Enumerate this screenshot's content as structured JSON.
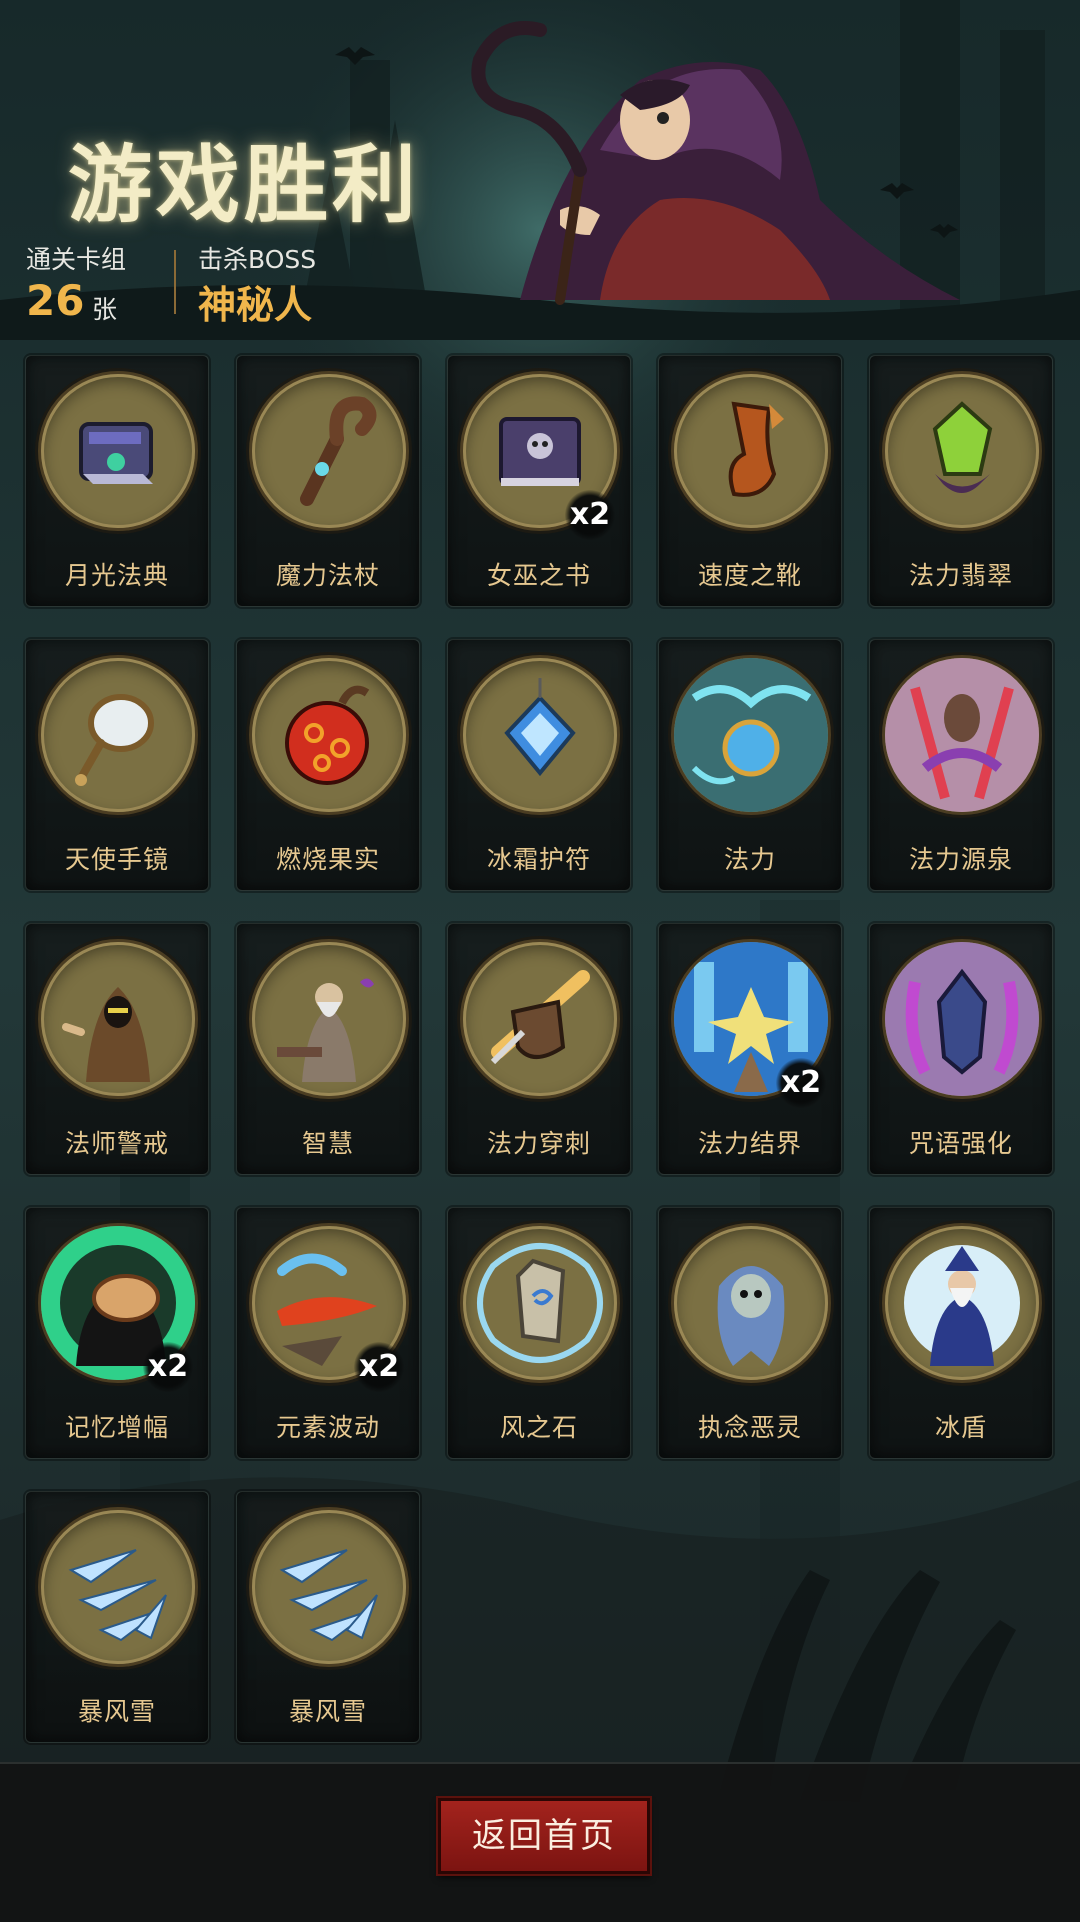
{
  "header": {
    "title": "游戏胜利",
    "deck_label": "通关卡组",
    "deck_count": "26",
    "deck_unit": "张",
    "boss_label": "击杀BOSS",
    "boss_name": "神秘人"
  },
  "cards": [
    {
      "name": "月光法典",
      "count": "",
      "icon": "moonlight-codex-icon"
    },
    {
      "name": "魔力法杖",
      "count": "",
      "icon": "magic-staff-icon"
    },
    {
      "name": "女巫之书",
      "count": "x2",
      "icon": "witch-book-icon"
    },
    {
      "name": "速度之靴",
      "count": "",
      "icon": "speed-boots-icon"
    },
    {
      "name": "法力翡翠",
      "count": "",
      "icon": "mana-emerald-icon"
    },
    {
      "name": "天使手镜",
      "count": "",
      "icon": "angel-mirror-icon"
    },
    {
      "name": "燃烧果实",
      "count": "",
      "icon": "burning-fruit-icon"
    },
    {
      "name": "冰霜护符",
      "count": "",
      "icon": "frost-amulet-icon"
    },
    {
      "name": "法力",
      "count": "",
      "icon": "mana-icon"
    },
    {
      "name": "法力源泉",
      "count": "",
      "icon": "mana-spring-icon"
    },
    {
      "name": "法师警戒",
      "count": "",
      "icon": "mage-vigilance-icon"
    },
    {
      "name": "智慧",
      "count": "",
      "icon": "wisdom-icon"
    },
    {
      "name": "法力穿刺",
      "count": "",
      "icon": "mana-pierce-icon"
    },
    {
      "name": "法力结界",
      "count": "x2",
      "icon": "mana-barrier-icon"
    },
    {
      "name": "咒语强化",
      "count": "",
      "icon": "spell-empower-icon"
    },
    {
      "name": "记忆增幅",
      "count": "x2",
      "icon": "memory-boost-icon"
    },
    {
      "name": "元素波动",
      "count": "x2",
      "icon": "elemental-surge-icon"
    },
    {
      "name": "风之石",
      "count": "",
      "icon": "wind-stone-icon"
    },
    {
      "name": "执念恶灵",
      "count": "",
      "icon": "obsessed-wraith-icon"
    },
    {
      "name": "冰盾",
      "count": "",
      "icon": "ice-shield-icon"
    },
    {
      "name": "暴风雪",
      "count": "",
      "icon": "blizzard-icon"
    },
    {
      "name": "暴风雪",
      "count": "",
      "icon": "blizzard-icon"
    }
  ],
  "footer": {
    "home_button": "返回首页"
  },
  "colors": {
    "accent_gold": "#f0b64c",
    "button_red": "#a3231d",
    "medal": "#7b7043"
  }
}
